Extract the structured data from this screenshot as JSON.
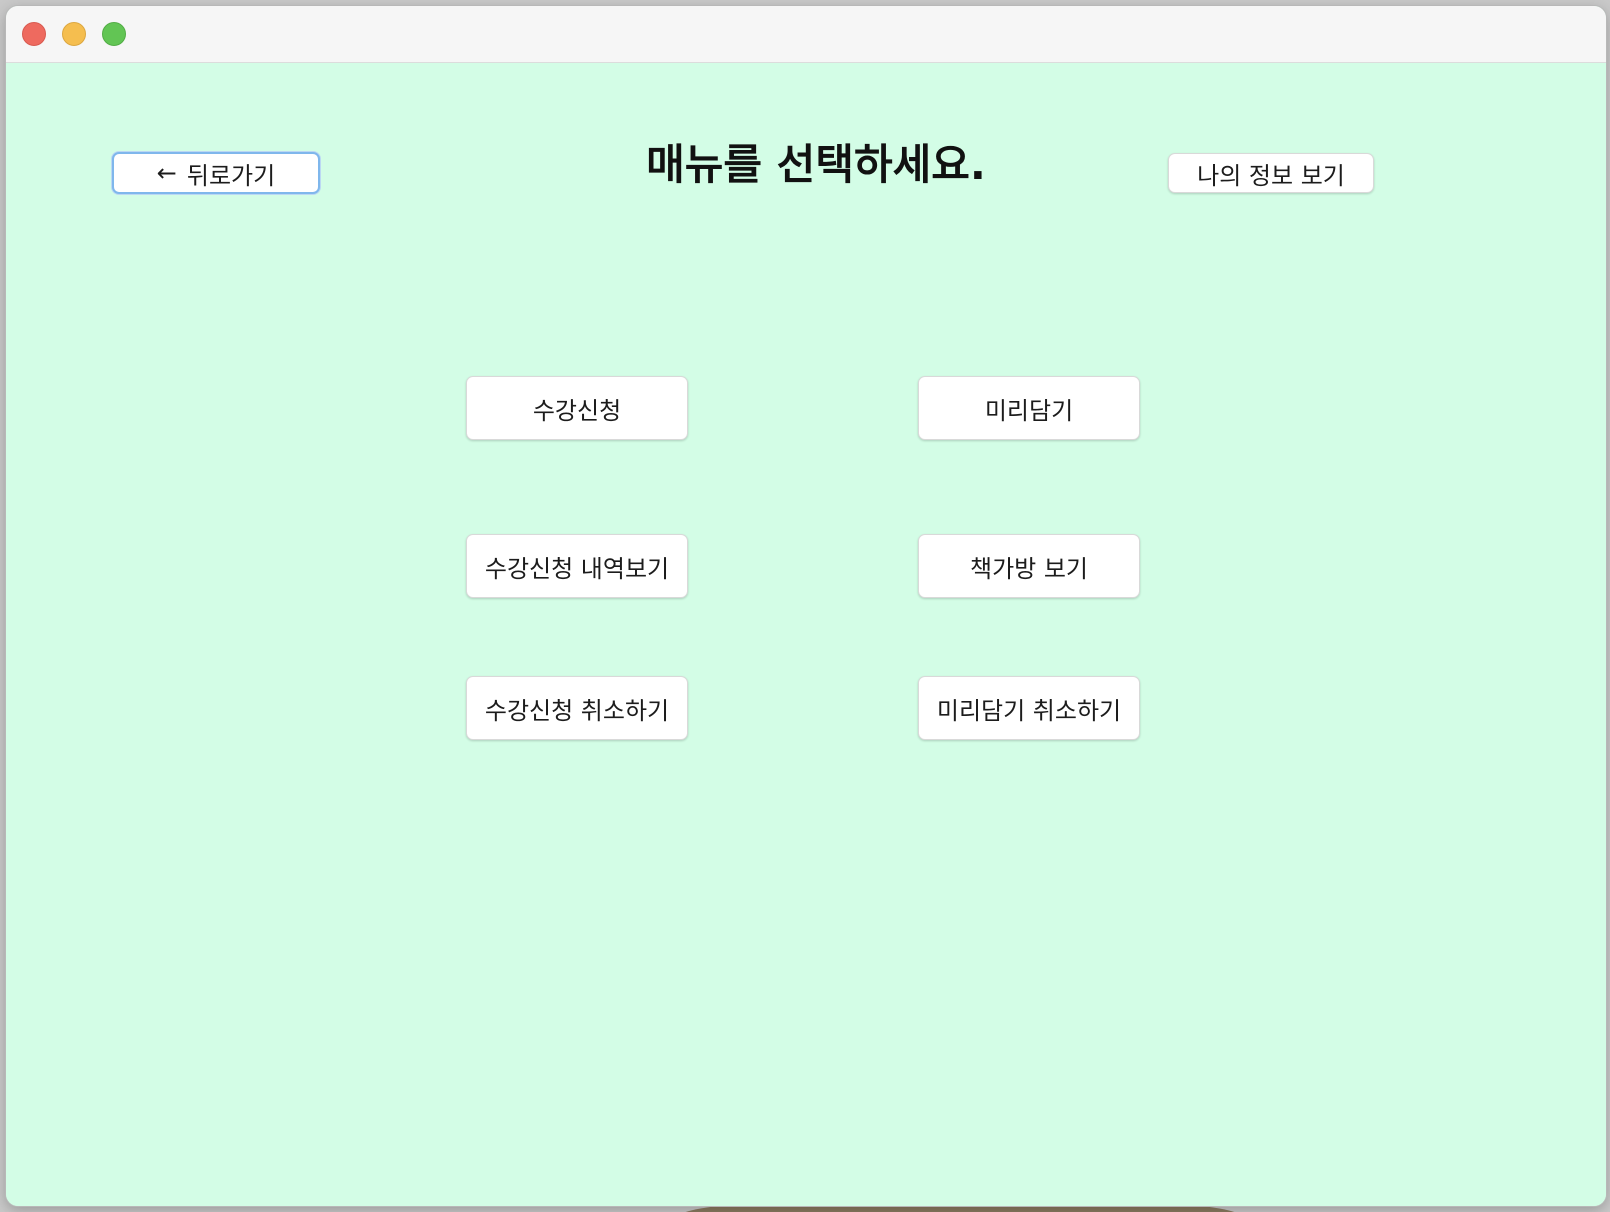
{
  "window": {
    "controls": [
      "close",
      "minimize",
      "zoom"
    ],
    "background_color": "#d3fde6"
  },
  "header": {
    "back_icon": "←",
    "back_label": "뒤로가기",
    "title": "매뉴를 선택하세요.",
    "my_info_label": "나의 정보 보기"
  },
  "menu": {
    "items": [
      {
        "label": "수강신청"
      },
      {
        "label": "미리담기"
      },
      {
        "label": "수강신청 내역보기"
      },
      {
        "label": "책가방 보기"
      },
      {
        "label": "수강신청 취소하기"
      },
      {
        "label": "미리담기 취소하기"
      }
    ]
  }
}
